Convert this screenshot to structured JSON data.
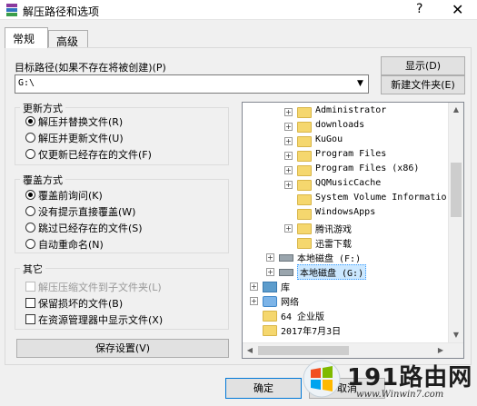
{
  "window": {
    "title": "解压路径和选项",
    "help_label": "?",
    "close_label": "✕"
  },
  "tabs": [
    {
      "label": "常规"
    },
    {
      "label": "高级"
    }
  ],
  "target": {
    "label": "目标路径(如果不存在将被创建)(P)",
    "value": "G:\\",
    "show_button": "显示(D)",
    "new_folder_button": "新建文件夹(E)"
  },
  "update_group": {
    "title": "更新方式",
    "options": [
      {
        "label": "解压并替换文件(R)",
        "selected": true
      },
      {
        "label": "解压并更新文件(U)",
        "selected": false
      },
      {
        "label": "仅更新已经存在的文件(F)",
        "selected": false
      }
    ]
  },
  "overwrite_group": {
    "title": "覆盖方式",
    "options": [
      {
        "label": "覆盖前询问(K)",
        "selected": true
      },
      {
        "label": "没有提示直接覆盖(W)",
        "selected": false
      },
      {
        "label": "跳过已经存在的文件(S)",
        "selected": false
      },
      {
        "label": "自动重命名(N)",
        "selected": false
      }
    ]
  },
  "other_group": {
    "title": "其它",
    "options": [
      {
        "label": "解压压缩文件到子文件夹(L)",
        "checked": false,
        "disabled": true
      },
      {
        "label": "保留损坏的文件(B)",
        "checked": false,
        "disabled": false
      },
      {
        "label": "在资源管理器中显示文件(X)",
        "checked": false,
        "disabled": false
      }
    ]
  },
  "save_button": "保存设置(V)",
  "tree": {
    "items": [
      {
        "label": "Administrator",
        "type": "folder",
        "expander": "+"
      },
      {
        "label": "downloads",
        "type": "folder",
        "expander": "+"
      },
      {
        "label": "KuGou",
        "type": "folder",
        "expander": "+"
      },
      {
        "label": "Program Files",
        "type": "folder",
        "expander": "+"
      },
      {
        "label": "Program Files (x86)",
        "type": "folder",
        "expander": "+"
      },
      {
        "label": "QQMusicCache",
        "type": "folder",
        "expander": "+"
      },
      {
        "label": "System Volume Informatio",
        "type": "folder",
        "expander": ""
      },
      {
        "label": "WindowsApps",
        "type": "folder",
        "expander": ""
      },
      {
        "label": "腾讯游戏",
        "type": "folder",
        "expander": "+"
      },
      {
        "label": "迅雷下载",
        "type": "folder",
        "expander": ""
      },
      {
        "label": "本地磁盘 (F:)",
        "type": "drive",
        "expander": "+"
      },
      {
        "label": "本地磁盘 (G:)",
        "type": "drive",
        "expander": "+",
        "selected": true
      },
      {
        "label": "库",
        "type": "lib",
        "expander": "+"
      },
      {
        "label": "网络",
        "type": "net",
        "expander": "+"
      },
      {
        "label": "64 企业版",
        "type": "folder",
        "expander": ""
      },
      {
        "label": "2017年7月3日",
        "type": "folder",
        "expander": ""
      }
    ]
  },
  "footer": {
    "ok_button": "确定",
    "cancel_button": "取消"
  },
  "watermark": {
    "brand": "191路由网",
    "site": "www.Winwin7.com"
  }
}
